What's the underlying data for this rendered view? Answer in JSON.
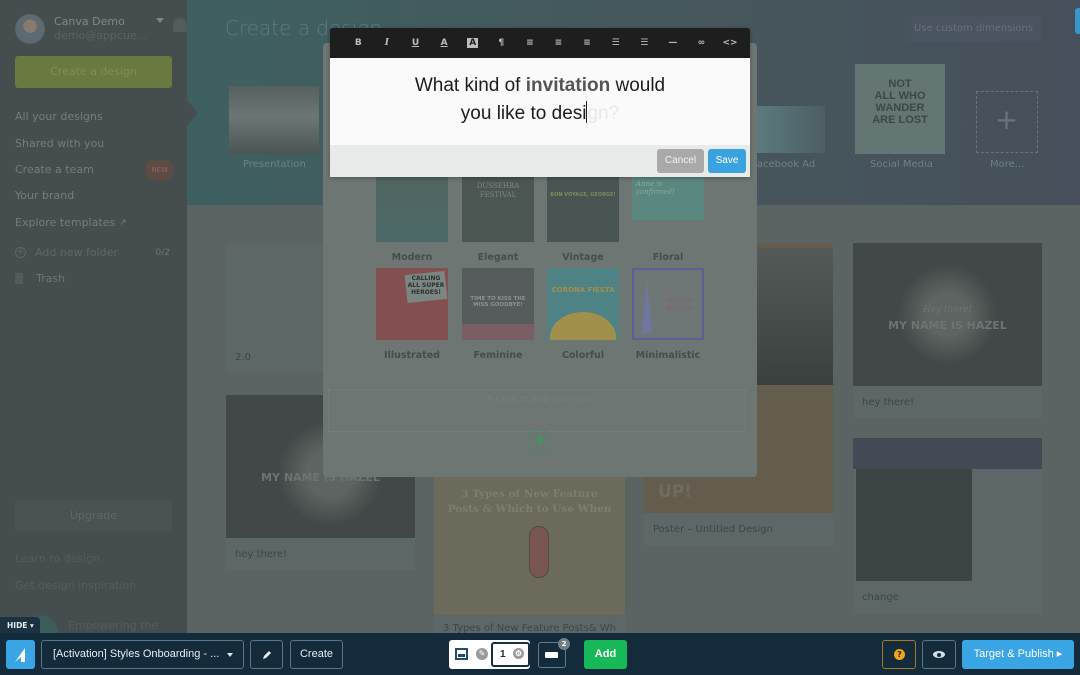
{
  "sidebar": {
    "user_name": "Canva Demo",
    "user_email": "demo@appcue...",
    "create_button": "Create a design",
    "nav": [
      {
        "label": "All your designs"
      },
      {
        "label": "Shared with you"
      },
      {
        "label": "Create a team",
        "badge": "NEW"
      },
      {
        "label": "Your brand"
      },
      {
        "label": "Explore templates",
        "external_icon": "↗"
      }
    ],
    "add_folder": "Add new folder",
    "folder_count": "0/2",
    "trash": "Trash",
    "upgrade": "Upgrade",
    "learn": "Learn to design",
    "inspiration": "Get design inspiration",
    "empowering": "Empowering the"
  },
  "top_band": {
    "title": "Create a design",
    "custom_dimensions": "Use custom dimensions",
    "types": [
      {
        "label": "Presentation"
      },
      {
        "label": "Facebook Ad"
      },
      {
        "label": "Social Media"
      },
      {
        "label": "More..."
      }
    ]
  },
  "designs": [
    {
      "label": "2.0"
    },
    {
      "label": "hey there!",
      "thumb_text": "MY NAME IS HAZEL"
    },
    {
      "label": "3 Types of New Feature Posts& Wh",
      "thumb_text": "3 Types of New Feature Posts & Which to Use When"
    },
    {
      "label": "Poster – Untitled Design",
      "thumb_text": "UP!"
    },
    {
      "label": "hey there!",
      "thumb_text": "MY NAME IS HAZEL",
      "thumb_sub": "Hey there!"
    },
    {
      "label": "change"
    }
  ],
  "modal": {
    "styles": [
      {
        "name": "Modern",
        "color": "#4f6560"
      },
      {
        "name": "Elegant",
        "color": "#4b5552",
        "thumb_text": "DUSSEHRA FESTIVAL"
      },
      {
        "name": "Vintage",
        "color": "#495553",
        "thumb_text": "BON VOYAGE, GEORGE!"
      },
      {
        "name": "Floral",
        "color": "#5b8781",
        "thumb_text": "Anne is confirmed!"
      },
      {
        "name": "Illustrated",
        "color": "#844f51",
        "thumb_text": "CALLING ALL SUPER HEROES!"
      },
      {
        "name": "Feminine",
        "color": "#5a5f5e",
        "thumb_text": "TIME TO KISS THE MISS GOODBYE!"
      },
      {
        "name": "Colorful",
        "color": "#4f8285",
        "thumb_text": "CORONA FIESTA"
      },
      {
        "name": "Minimalistic",
        "color": "#6e7775",
        "thumb_text": "Parisian Banquet"
      }
    ],
    "click_to_add": "¶ Click to add your text"
  },
  "editor": {
    "toolbar": [
      {
        "name": "bold-icon",
        "glyph": "B"
      },
      {
        "name": "italic-icon",
        "glyph": "I"
      },
      {
        "name": "underline-icon",
        "glyph": "U"
      },
      {
        "name": "text-color-icon",
        "glyph": "A"
      },
      {
        "name": "highlight-icon",
        "glyph": "A"
      },
      {
        "name": "paragraph-icon",
        "glyph": "¶"
      },
      {
        "name": "align-left-icon",
        "glyph": "≡"
      },
      {
        "name": "align-right-icon",
        "glyph": "≡"
      },
      {
        "name": "indent-icon",
        "glyph": "≡"
      },
      {
        "name": "bulleted-list-icon",
        "glyph": "☰"
      },
      {
        "name": "numbered-list-icon",
        "glyph": "☰"
      },
      {
        "name": "horizontal-rule-icon",
        "glyph": "—"
      },
      {
        "name": "link-icon",
        "glyph": "∞"
      },
      {
        "name": "code-icon",
        "glyph": "<>"
      }
    ],
    "line1_pre": "What kind of ",
    "line1_bold": "invitation",
    "line1_post": " would",
    "line2": "you like to desi",
    "line2_ghost": "gn?",
    "cancel": "Cancel",
    "save": "Save"
  },
  "bottom_bar": {
    "hide": "HIDE ▾",
    "flow_name": "[Activation] Styles Onboarding - ...",
    "create": "Create",
    "step_number": "1",
    "comment_count": "2",
    "add": "Add",
    "help": "?",
    "publish": "Target & Publish ▸"
  }
}
